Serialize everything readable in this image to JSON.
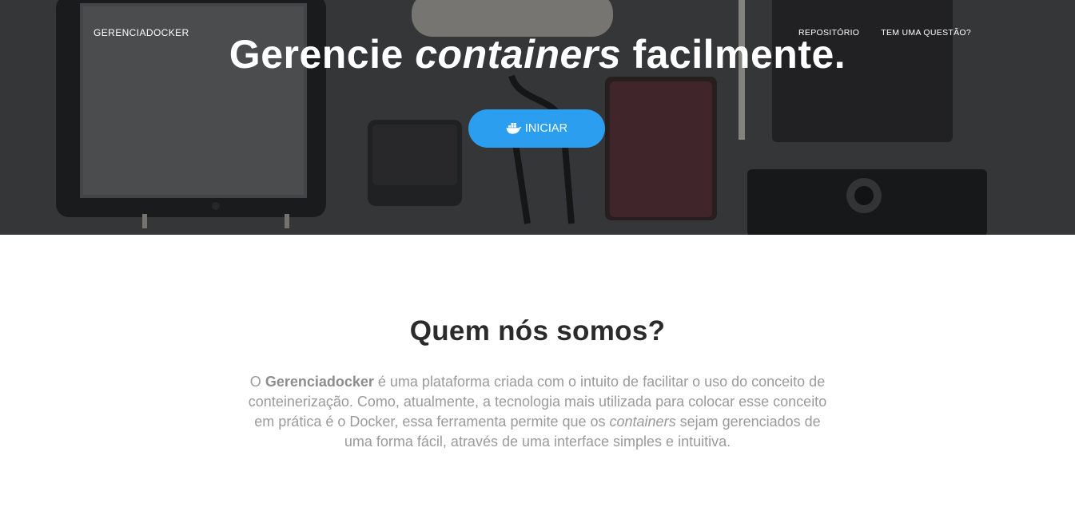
{
  "navbar": {
    "brand": "GERENCIADOCKER",
    "links": [
      "REPOSITÓRIO",
      "TEM UMA QUESTÃO?"
    ]
  },
  "hero": {
    "headline_before": "Gerencie",
    "headline_em": "containers",
    "headline_after": "facilmente.",
    "cta_icon": "docker-whale-icon",
    "cta_label": "INICIAR"
  },
  "about": {
    "title": "Quem nós somos?",
    "text_1": "O ",
    "text_brand": "Gerenciadocker",
    "text_2": " é uma plataforma criada com o intuito de facilitar o uso do conceito de conteinerização. Como, atualmente, a tecnologia mais utilizada para colocar esse conceito em prática é o Docker, essa ferramenta permite que os ",
    "text_em": "containers",
    "text_3": " sejam gerenciados de uma forma fácil, através de uma interface simples e intuitiva."
  },
  "colors": {
    "accent": "#2c9ef0",
    "hero_background": "#3b3d3f",
    "heading": "#2b2b2b",
    "body_text": "#9a9a9a"
  }
}
